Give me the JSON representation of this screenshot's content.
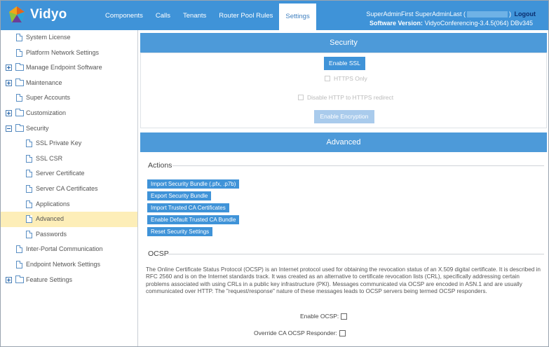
{
  "header": {
    "brand": "Vidyo",
    "nav": [
      "Components",
      "Calls",
      "Tenants",
      "Router Pool Rules",
      "Settings"
    ],
    "active_nav": "Settings",
    "user_name": "SuperAdminFirst SuperAdminLast (",
    "user_close": ")",
    "logout": "Logout",
    "version_label": "Software Version:",
    "version_value": "VidyoConferencing-3.4.5(064) DBv345"
  },
  "sidebar": {
    "items": [
      {
        "label": "System License"
      },
      {
        "label": "Platform Network Settings"
      },
      {
        "label": "Manage Endpoint Software"
      },
      {
        "label": "Maintenance"
      },
      {
        "label": "Super Accounts"
      },
      {
        "label": "Customization"
      },
      {
        "label": "Security"
      },
      {
        "label": "SSL Private Key"
      },
      {
        "label": "SSL CSR"
      },
      {
        "label": "Server Certificate"
      },
      {
        "label": "Server CA Certificates"
      },
      {
        "label": "Applications"
      },
      {
        "label": "Advanced"
      },
      {
        "label": "Passwords"
      },
      {
        "label": "Inter-Portal Communication"
      },
      {
        "label": "Endpoint Network Settings"
      },
      {
        "label": "Feature Settings"
      }
    ]
  },
  "security": {
    "title": "Security",
    "enable_ssl": "Enable SSL",
    "https_only": "HTTPS Only",
    "disable_http_redirect": "Disable HTTP to HTTPS redirect",
    "enable_encryption": "Enable Encryption"
  },
  "advanced": {
    "title": "Advanced",
    "actions_legend": "Actions",
    "actions": [
      "Import Security Bundle (.pfx, .p7b)",
      "Export Security Bundle",
      "Import Trusted CA Certificates",
      "Enable Default Trusted CA Bundle",
      "Reset Security Settings"
    ],
    "ocsp_legend": "OCSP",
    "ocsp_description": "The Online Certificate Status Protocol (OCSP) is an Internet protocol used for obtaining the revocation status of an X.509 digital certificate. It is described in RFC 2560 and is on the Internet standards track. It was created as an alternative to certificate revocation lists (CRL), specifically addressing certain problems associated with using CRLs in a public key infrastructure (PKI). Messages communicated via OCSP are encoded in ASN.1 and are usually communicated over HTTP. The \"request/response\" nature of these messages leads to OCSP servers being termed OCSP responders.",
    "enable_ocsp_label": "Enable OCSP:",
    "override_responder_label": "Override CA OCSP Responder:"
  },
  "colors": {
    "header_blue": "#3f93d8",
    "section_blue": "#4d9ad9",
    "selected_row": "#fdeeb8",
    "logout": "#0b2e6e"
  }
}
